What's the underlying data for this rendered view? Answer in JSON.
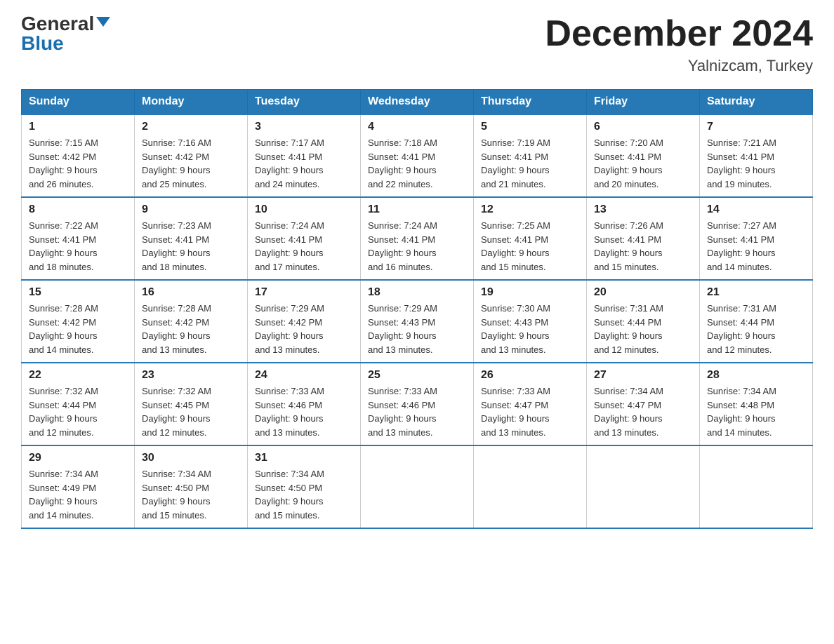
{
  "header": {
    "logo_general": "General",
    "logo_blue": "Blue",
    "title": "December 2024",
    "location": "Yalnizcam, Turkey"
  },
  "weekdays": [
    "Sunday",
    "Monday",
    "Tuesday",
    "Wednesday",
    "Thursday",
    "Friday",
    "Saturday"
  ],
  "weeks": [
    [
      {
        "day": "1",
        "sunrise": "7:15 AM",
        "sunset": "4:42 PM",
        "daylight": "9 hours and 26 minutes."
      },
      {
        "day": "2",
        "sunrise": "7:16 AM",
        "sunset": "4:42 PM",
        "daylight": "9 hours and 25 minutes."
      },
      {
        "day": "3",
        "sunrise": "7:17 AM",
        "sunset": "4:41 PM",
        "daylight": "9 hours and 24 minutes."
      },
      {
        "day": "4",
        "sunrise": "7:18 AM",
        "sunset": "4:41 PM",
        "daylight": "9 hours and 22 minutes."
      },
      {
        "day": "5",
        "sunrise": "7:19 AM",
        "sunset": "4:41 PM",
        "daylight": "9 hours and 21 minutes."
      },
      {
        "day": "6",
        "sunrise": "7:20 AM",
        "sunset": "4:41 PM",
        "daylight": "9 hours and 20 minutes."
      },
      {
        "day": "7",
        "sunrise": "7:21 AM",
        "sunset": "4:41 PM",
        "daylight": "9 hours and 19 minutes."
      }
    ],
    [
      {
        "day": "8",
        "sunrise": "7:22 AM",
        "sunset": "4:41 PM",
        "daylight": "9 hours and 18 minutes."
      },
      {
        "day": "9",
        "sunrise": "7:23 AM",
        "sunset": "4:41 PM",
        "daylight": "9 hours and 18 minutes."
      },
      {
        "day": "10",
        "sunrise": "7:24 AM",
        "sunset": "4:41 PM",
        "daylight": "9 hours and 17 minutes."
      },
      {
        "day": "11",
        "sunrise": "7:24 AM",
        "sunset": "4:41 PM",
        "daylight": "9 hours and 16 minutes."
      },
      {
        "day": "12",
        "sunrise": "7:25 AM",
        "sunset": "4:41 PM",
        "daylight": "9 hours and 15 minutes."
      },
      {
        "day": "13",
        "sunrise": "7:26 AM",
        "sunset": "4:41 PM",
        "daylight": "9 hours and 15 minutes."
      },
      {
        "day": "14",
        "sunrise": "7:27 AM",
        "sunset": "4:41 PM",
        "daylight": "9 hours and 14 minutes."
      }
    ],
    [
      {
        "day": "15",
        "sunrise": "7:28 AM",
        "sunset": "4:42 PM",
        "daylight": "9 hours and 14 minutes."
      },
      {
        "day": "16",
        "sunrise": "7:28 AM",
        "sunset": "4:42 PM",
        "daylight": "9 hours and 13 minutes."
      },
      {
        "day": "17",
        "sunrise": "7:29 AM",
        "sunset": "4:42 PM",
        "daylight": "9 hours and 13 minutes."
      },
      {
        "day": "18",
        "sunrise": "7:29 AM",
        "sunset": "4:43 PM",
        "daylight": "9 hours and 13 minutes."
      },
      {
        "day": "19",
        "sunrise": "7:30 AM",
        "sunset": "4:43 PM",
        "daylight": "9 hours and 13 minutes."
      },
      {
        "day": "20",
        "sunrise": "7:31 AM",
        "sunset": "4:44 PM",
        "daylight": "9 hours and 12 minutes."
      },
      {
        "day": "21",
        "sunrise": "7:31 AM",
        "sunset": "4:44 PM",
        "daylight": "9 hours and 12 minutes."
      }
    ],
    [
      {
        "day": "22",
        "sunrise": "7:32 AM",
        "sunset": "4:44 PM",
        "daylight": "9 hours and 12 minutes."
      },
      {
        "day": "23",
        "sunrise": "7:32 AM",
        "sunset": "4:45 PM",
        "daylight": "9 hours and 12 minutes."
      },
      {
        "day": "24",
        "sunrise": "7:33 AM",
        "sunset": "4:46 PM",
        "daylight": "9 hours and 13 minutes."
      },
      {
        "day": "25",
        "sunrise": "7:33 AM",
        "sunset": "4:46 PM",
        "daylight": "9 hours and 13 minutes."
      },
      {
        "day": "26",
        "sunrise": "7:33 AM",
        "sunset": "4:47 PM",
        "daylight": "9 hours and 13 minutes."
      },
      {
        "day": "27",
        "sunrise": "7:34 AM",
        "sunset": "4:47 PM",
        "daylight": "9 hours and 13 minutes."
      },
      {
        "day": "28",
        "sunrise": "7:34 AM",
        "sunset": "4:48 PM",
        "daylight": "9 hours and 14 minutes."
      }
    ],
    [
      {
        "day": "29",
        "sunrise": "7:34 AM",
        "sunset": "4:49 PM",
        "daylight": "9 hours and 14 minutes."
      },
      {
        "day": "30",
        "sunrise": "7:34 AM",
        "sunset": "4:50 PM",
        "daylight": "9 hours and 15 minutes."
      },
      {
        "day": "31",
        "sunrise": "7:34 AM",
        "sunset": "4:50 PM",
        "daylight": "9 hours and 15 minutes."
      },
      null,
      null,
      null,
      null
    ]
  ],
  "labels": {
    "sunrise": "Sunrise:",
    "sunset": "Sunset:",
    "daylight": "Daylight:"
  }
}
